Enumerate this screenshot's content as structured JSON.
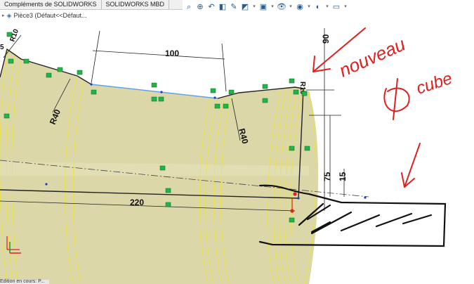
{
  "tabs": [
    "Compléments de SOLIDWORKS",
    "SOLIDWORKS MBD"
  ],
  "tree": {
    "part_label": "Pièce3  (Défaut<<Défaut..."
  },
  "toolbar": {
    "icons": [
      "search-icon",
      "zoom-area-icon",
      "previous-view-icon",
      "section-view-icon",
      "dynamic-annotation-icon",
      "view-orientation-icon",
      "display-style-icon",
      "hide-show-icon",
      "edit-appearance-icon",
      "apply-scene-icon",
      "view-settings-icon"
    ]
  },
  "sketch": {
    "dimensions": {
      "d100": "100",
      "d220": "220",
      "d75": "75",
      "d15": "15",
      "d90": "90",
      "r40_left": "R40",
      "r40_right": "R40",
      "r10_left": "R10",
      "r10_right": "R10",
      "d5": "5"
    }
  },
  "annotation": {
    "line1": "nouveau",
    "line2": "cube"
  },
  "status": {
    "text": "Edition en cours: P..."
  }
}
